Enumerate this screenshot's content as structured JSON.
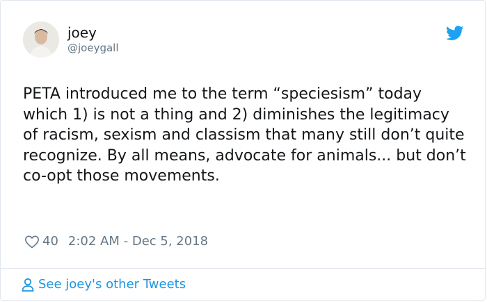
{
  "user": {
    "display_name": "joey",
    "handle": "@joeygall"
  },
  "tweet": {
    "text": "PETA introduced me to the term “speciesism” today which 1) is not a thing and 2) diminishes the legitimacy of racism, sexism and classism that many still don’t quite recognize. By all means, advocate for animals... but don’t co-opt those movements.",
    "likes": "40",
    "timestamp": "2:02 AM - Dec 5, 2018"
  },
  "footer": {
    "link_label": "See joey's other Tweets"
  },
  "icons": {
    "brand": "twitter-bird-icon",
    "like": "heart-icon",
    "profile": "person-icon"
  },
  "colors": {
    "brand_blue": "#1da1f2",
    "link_blue": "#1b95e0",
    "secondary_text": "#657786",
    "border": "#e1e8ed"
  }
}
